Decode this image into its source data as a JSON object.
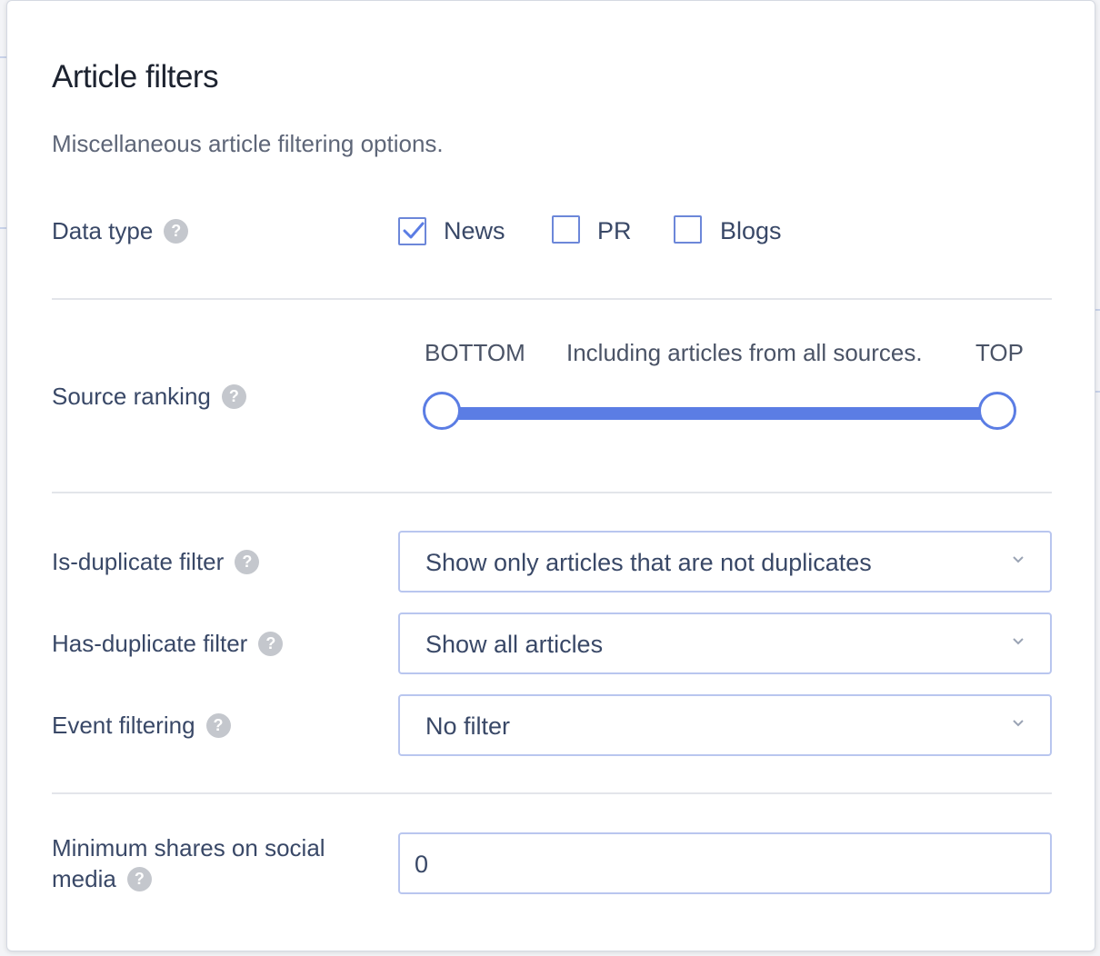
{
  "dialog": {
    "title": "Article filters",
    "subtitle": "Miscellaneous article filtering options."
  },
  "data_type": {
    "label": "Data type",
    "options": [
      {
        "label": "News",
        "checked": true
      },
      {
        "label": "PR",
        "checked": false
      },
      {
        "label": "Blogs",
        "checked": false
      }
    ]
  },
  "source_ranking": {
    "label": "Source ranking",
    "left_cap": "BOTTOM",
    "right_cap": "TOP",
    "status": "Including articles from all sources.",
    "range": [
      0,
      1
    ]
  },
  "is_duplicate": {
    "label": "Is-duplicate filter",
    "selected": "Show only articles that are not duplicates"
  },
  "has_duplicate": {
    "label": "Has-duplicate filter",
    "selected": "Show all articles"
  },
  "event_filtering": {
    "label": "Event filtering",
    "selected": "No filter"
  },
  "min_shares": {
    "label_line1": "Minimum shares on social",
    "label_line2": "media",
    "value": "0"
  },
  "help_glyph": "?",
  "colors": {
    "accent": "#5b7de4",
    "field_border": "#b9c6ef",
    "text": "#394867",
    "help_icon": "#c4c7cd"
  }
}
